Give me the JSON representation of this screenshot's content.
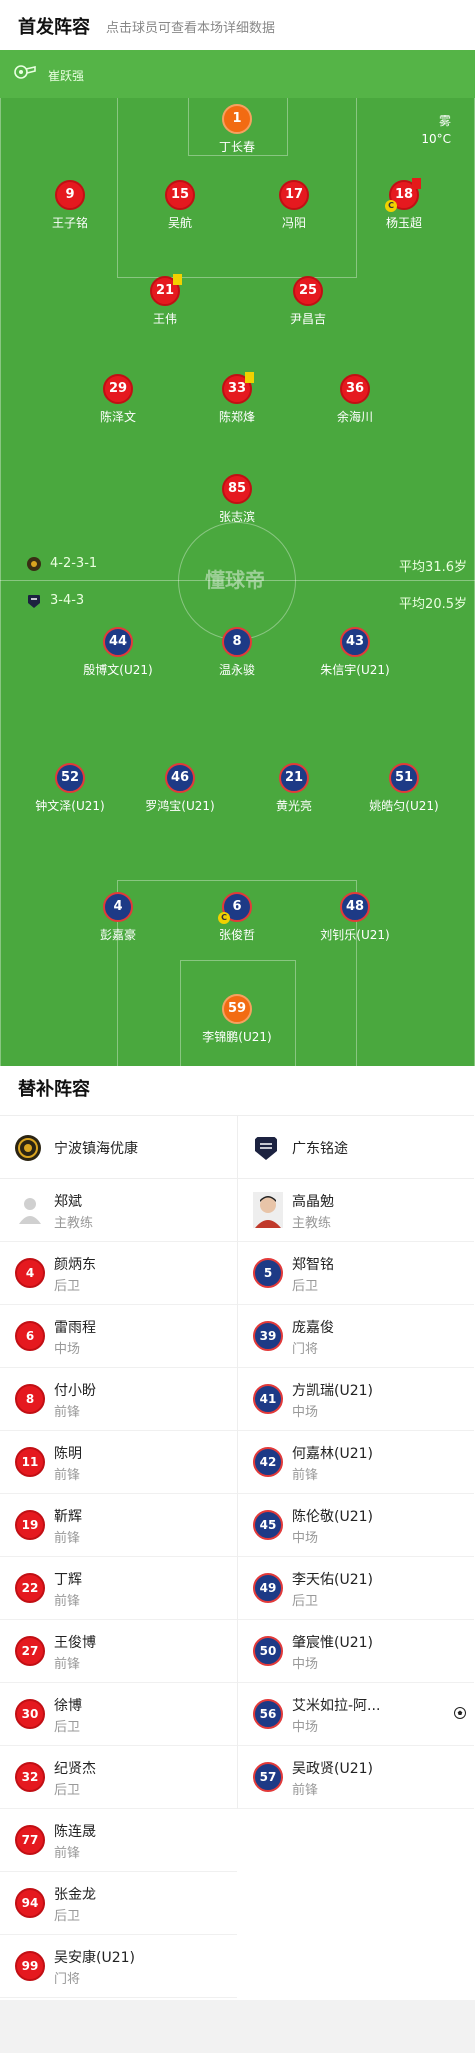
{
  "header": {
    "title": "首发阵容",
    "subtitle": "点击球员可查看本场详细数据"
  },
  "referee": {
    "name": "崔跃强"
  },
  "weather": {
    "condition": "雾",
    "temperature": "10°C"
  },
  "watermark": "懂球帝",
  "home_team": {
    "name": "宁波镇海优康",
    "formation": "4-2-3-1",
    "avg_age": "平均31.6岁"
  },
  "away_team": {
    "name": "广东铭途",
    "formation": "3-4-3",
    "avg_age": "平均20.5岁"
  },
  "home_starters": [
    {
      "number": "1",
      "name": "丁长春",
      "role": "gk"
    },
    {
      "number": "9",
      "name": "王子铭"
    },
    {
      "number": "15",
      "name": "吴航"
    },
    {
      "number": "17",
      "name": "冯阳"
    },
    {
      "number": "18",
      "name": "杨玉超",
      "captain": true,
      "red_card": true
    },
    {
      "number": "21",
      "name": "王伟",
      "yellow_card": true
    },
    {
      "number": "25",
      "name": "尹昌吉"
    },
    {
      "number": "29",
      "name": "陈泽文"
    },
    {
      "number": "33",
      "name": "陈郑烽",
      "yellow_card": true
    },
    {
      "number": "36",
      "name": "余海川"
    },
    {
      "number": "85",
      "name": "张志滨"
    }
  ],
  "away_starters": [
    {
      "number": "44",
      "name": "殷博文(U21)"
    },
    {
      "number": "8",
      "name": "温永骏"
    },
    {
      "number": "43",
      "name": "朱信宇(U21)"
    },
    {
      "number": "52",
      "name": "钟文泽(U21)"
    },
    {
      "number": "46",
      "name": "罗鸿宝(U21)"
    },
    {
      "number": "21",
      "name": "黄光亮"
    },
    {
      "number": "51",
      "name": "姚皓匀(U21)"
    },
    {
      "number": "4",
      "name": "彭嘉豪"
    },
    {
      "number": "6",
      "name": "张俊哲",
      "captain": true
    },
    {
      "number": "48",
      "name": "刘钊乐(U21)"
    },
    {
      "number": "59",
      "name": "李锦鹏(U21)",
      "role": "gk"
    }
  ],
  "captain_mark": "C",
  "subs": {
    "title": "替补阵容",
    "home_coach": {
      "name": "郑斌",
      "role": "主教练"
    },
    "away_coach": {
      "name": "高晶勉",
      "role": "主教练"
    },
    "home": [
      {
        "number": "4",
        "name": "颜炳东",
        "pos": "后卫"
      },
      {
        "number": "6",
        "name": "雷雨程",
        "pos": "中场"
      },
      {
        "number": "8",
        "name": "付小盼",
        "pos": "前锋"
      },
      {
        "number": "11",
        "name": "陈明",
        "pos": "前锋"
      },
      {
        "number": "19",
        "name": "靳辉",
        "pos": "前锋"
      },
      {
        "number": "22",
        "name": "丁辉",
        "pos": "前锋"
      },
      {
        "number": "27",
        "name": "王俊博",
        "pos": "前锋"
      },
      {
        "number": "30",
        "name": "徐博",
        "pos": "后卫"
      },
      {
        "number": "32",
        "name": "纪贤杰",
        "pos": "后卫"
      },
      {
        "number": "77",
        "name": "陈连晟",
        "pos": "前锋"
      },
      {
        "number": "94",
        "name": "张金龙",
        "pos": "后卫"
      },
      {
        "number": "99",
        "name": "吴安康(U21)",
        "pos": "门将"
      }
    ],
    "away": [
      {
        "number": "5",
        "name": "郑智铭",
        "pos": "后卫"
      },
      {
        "number": "39",
        "name": "庞嘉俊",
        "pos": "门将"
      },
      {
        "number": "41",
        "name": "方凯瑞(U21)",
        "pos": "中场"
      },
      {
        "number": "42",
        "name": "何嘉林(U21)",
        "pos": "前锋"
      },
      {
        "number": "45",
        "name": "陈伦敬(U21)",
        "pos": "中场"
      },
      {
        "number": "49",
        "name": "李天佑(U21)",
        "pos": "后卫"
      },
      {
        "number": "50",
        "name": "肇宸惟(U21)",
        "pos": "中场"
      },
      {
        "number": "56",
        "name": "艾米如拉-阿...",
        "pos": "中场",
        "goal": true
      },
      {
        "number": "57",
        "name": "吴政贤(U21)",
        "pos": "前锋"
      }
    ]
  },
  "colors": {
    "pitch": "#4aa83e",
    "home": "#e5191f",
    "away": "#1d3a86",
    "gk": "#f26b12"
  }
}
